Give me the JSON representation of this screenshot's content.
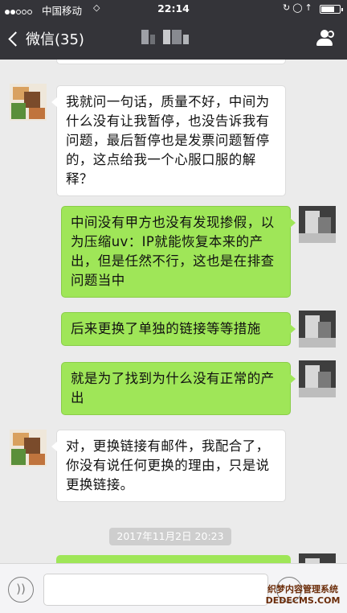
{
  "status_bar": {
    "carrier": "中国移动",
    "time": "22:14"
  },
  "nav": {
    "back_label": "微信(35)"
  },
  "messages": [
    {
      "side": "in",
      "text": "我就问一句话，质量不好，中间为什么没有让我暂停，也没告诉我有问题，最后暂停也是发票问题暂停的，这点给我一个心服口服的解释？"
    },
    {
      "side": "out",
      "text": "中间没有甲方也没有发现掺假，以为压缩uv：IP就能恢复本来的产出，但是任然不行，这也是在排查问题当中"
    },
    {
      "side": "out",
      "text": "后来更换了单独的链接等等措施"
    },
    {
      "side": "out",
      "text": "就是为了找到为什么没有正常的产出"
    },
    {
      "side": "in",
      "text": "对，更换链接有邮件，我配合了，  你没有说任何更换的理由，只是说更换链接。"
    }
  ],
  "timestamp": "2017年11月2日 20:23",
  "watermark": {
    "line1": "织梦内容管理系统",
    "line2": "DEDECMS.COM"
  },
  "colors": {
    "navbar": "#343439",
    "chat_background": "#ebebeb",
    "outgoing_bubble": "#9fe658",
    "incoming_bubble": "#ffffff"
  }
}
